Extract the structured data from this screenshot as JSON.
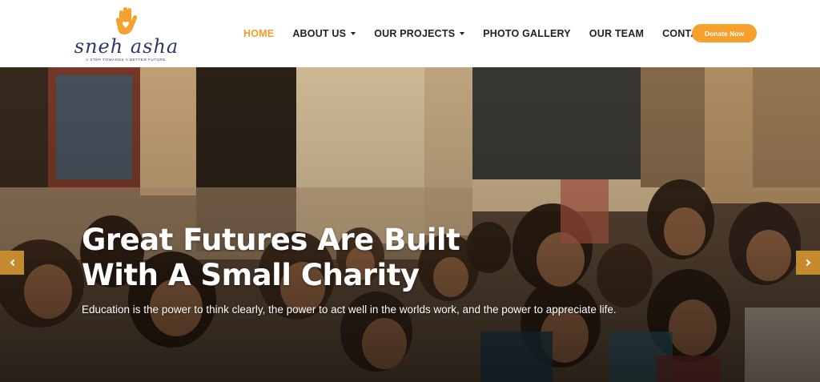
{
  "brand": {
    "name": "sneh asha",
    "tagline": "A STEP TOWARDS A BETTER FUTURE."
  },
  "nav": {
    "items": [
      {
        "label": "HOME",
        "active": true,
        "dropdown": false
      },
      {
        "label": "ABOUT US",
        "active": false,
        "dropdown": true
      },
      {
        "label": "OUR PROJECTS",
        "active": false,
        "dropdown": true
      },
      {
        "label": "PHOTO GALLERY",
        "active": false,
        "dropdown": false
      },
      {
        "label": "OUR TEAM",
        "active": false,
        "dropdown": false
      },
      {
        "label": "CONTACT",
        "active": false,
        "dropdown": false
      }
    ],
    "donate_label": "Donate Now"
  },
  "hero": {
    "title_line1": "Great Futures Are Built",
    "title_line2": "With A Small Charity",
    "subtitle": "Education is the power to think clearly, the power to act well in the worlds work, and the power to appreciate life."
  },
  "colors": {
    "accent": "#f39c2c",
    "donate_bg": "#f7a02c",
    "slider_arrow_bg": "#c48a2e",
    "brand_text": "#2d3a6b"
  },
  "icons": {
    "logo": "hand-heart-icon",
    "prev": "chevron-left-icon",
    "next": "chevron-right-icon"
  }
}
